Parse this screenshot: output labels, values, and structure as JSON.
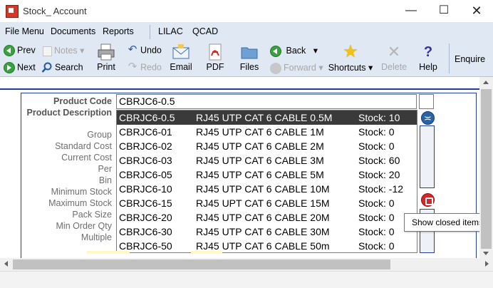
{
  "window": {
    "title": "Stock_ Account",
    "minimize": "—",
    "maximize": "☐",
    "close": "✕"
  },
  "menu": [
    "File Menu",
    "Documents",
    "Reports",
    "LILAC",
    "QCAD"
  ],
  "toolbar": {
    "prev": "Prev",
    "next": "Next",
    "notes": "Notes",
    "search": "Search",
    "print": "Print",
    "undo": "Undo",
    "redo": "Redo",
    "email": "Email",
    "pdf": "PDF",
    "files": "Files",
    "back": "Back",
    "forward": "Forward",
    "shortcuts": "Shortcuts",
    "delete": "Delete",
    "help": "Help",
    "enquire": "Enquire"
  },
  "form": {
    "labels": {
      "product_code": "Product Code",
      "product_description": "Product Description",
      "group": "Group",
      "standard_cost": "Standard Cost",
      "current_cost": "Current Cost",
      "per": "Per",
      "bin": "Bin",
      "minimum_stock": "Minimum Stock",
      "maximum_stock": "Maximum Stock",
      "pack_size": "Pack Size",
      "min_order_qty": "Min Order Qty",
      "multiple": "Multiple"
    },
    "product_code_value": "CBRJC6-0.5"
  },
  "dropdown": {
    "selected_index": 0,
    "rows": [
      {
        "code": "CBRJC6-0.5",
        "description": "RJ45 UTP CAT 6 CABLE 0.5M",
        "stock": "Stock: 10"
      },
      {
        "code": "CBRJC6-01",
        "description": "RJ45 UTP CAT 6 CABLE 1M",
        "stock": "Stock: 0"
      },
      {
        "code": "CBRJC6-02",
        "description": "RJ45 UTP CAT 6 CABLE 2M",
        "stock": "Stock: 0"
      },
      {
        "code": "CBRJC6-03",
        "description": "RJ45 UTP CAT 6 CABLE 3M",
        "stock": "Stock: 60"
      },
      {
        "code": "CBRJC6-05",
        "description": "RJ45 UTP CAT 6 CABLE 5M",
        "stock": "Stock: 20"
      },
      {
        "code": "CBRJC6-10",
        "description": "RJ45 UTP CAT 6 CABLE 10M",
        "stock": "Stock: -12"
      },
      {
        "code": "CBRJC6-15",
        "description": "RJ45 UPT CAT 6 CABLE 15M",
        "stock": "Stock: 0"
      },
      {
        "code": "CBRJC6-20",
        "description": "RJ45 UTP CAT 6 CABLE 20M",
        "stock": "Stock: 0"
      },
      {
        "code": "CBRJC6-30",
        "description": "RJ45 UTP CAT 6 CABLE 30M",
        "stock": "Stock: 0"
      },
      {
        "code": "CBRJC6-50",
        "description": "RJ45 UTP CAT 6 CABLE 50m",
        "stock": "Stock: 0"
      }
    ]
  },
  "tooltip": "Show closed items",
  "colors": {
    "accent": "#1f3f9f",
    "toolbar_bg": "#dfe8f3",
    "selected_row": "#3a3a3a"
  },
  "icons": [
    "app-icon",
    "prev-icon",
    "next-icon",
    "notes-icon",
    "search-icon",
    "print-icon",
    "undo-icon",
    "redo-icon",
    "email-icon",
    "pdf-icon",
    "files-icon",
    "back-icon",
    "forward-icon",
    "shortcuts-star-icon",
    "delete-icon",
    "help-icon"
  ]
}
